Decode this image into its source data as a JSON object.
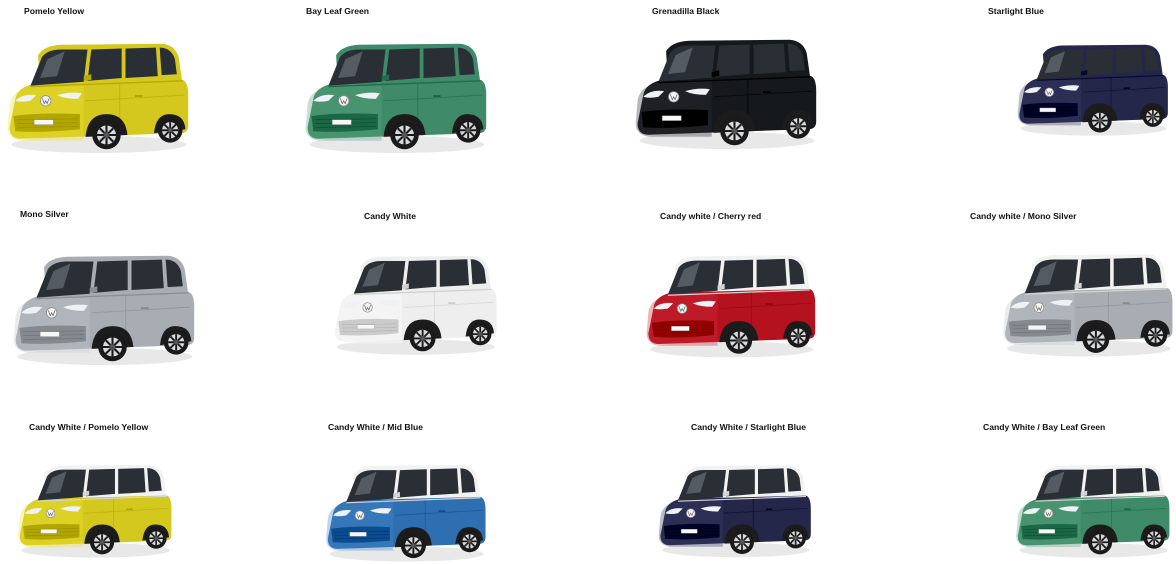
{
  "colors": [
    {
      "label": "Pomelo Yellow",
      "body": "#d4c81e",
      "roof": "#d4c81e",
      "two_tone": false
    },
    {
      "label": "Bay Leaf Green",
      "body": "#3f8a68",
      "roof": "#3f8a68",
      "two_tone": false
    },
    {
      "label": "Grenadilla Black",
      "body": "#15181c",
      "roof": "#15181c",
      "two_tone": false
    },
    {
      "label": "Starlight Blue",
      "body": "#24264a",
      "roof": "#24264a",
      "two_tone": false
    },
    {
      "label": "Mono Silver",
      "body": "#a8adb3",
      "roof": "#a8adb3",
      "two_tone": false
    },
    {
      "label": "Candy White",
      "body": "#eeeeee",
      "roof": "#eeeeee",
      "two_tone": false
    },
    {
      "label": "Candy white / Cherry red",
      "body": "#b5121f",
      "roof": "#f2f2f2",
      "two_tone": true
    },
    {
      "label": "Candy white / Mono Silver",
      "body": "#a8adb3",
      "roof": "#f2f2f2",
      "two_tone": true
    },
    {
      "label": "Candy White / Pomelo Yellow",
      "body": "#d4c81e",
      "roof": "#f2f2f2",
      "two_tone": true
    },
    {
      "label": "Candy White / Mid Blue",
      "body": "#2d6fb0",
      "roof": "#f2f2f2",
      "two_tone": true
    },
    {
      "label": "Candy White / Starlight Blue",
      "body": "#24264a",
      "roof": "#f2f2f2",
      "two_tone": true
    },
    {
      "label": "Candy White / Bay Leaf Green",
      "body": "#3f8a68",
      "roof": "#f2f2f2",
      "two_tone": true
    }
  ]
}
